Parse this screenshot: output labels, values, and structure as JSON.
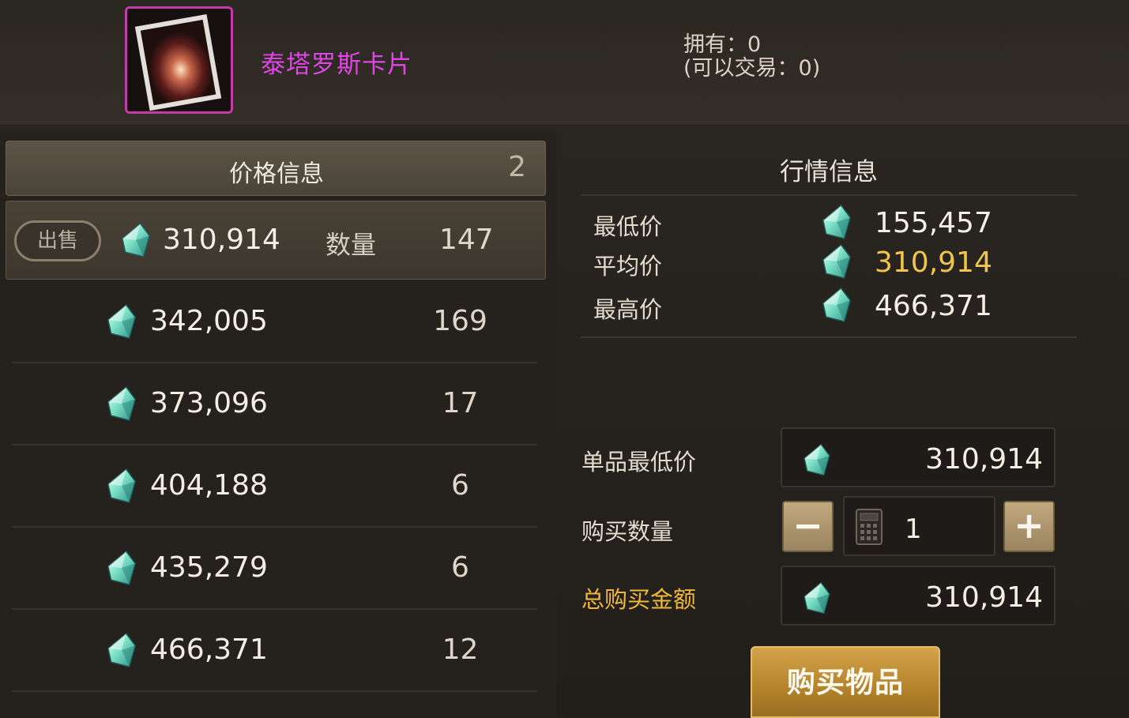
{
  "item": {
    "name": "泰塔罗斯卡片",
    "owned": "拥有：0",
    "tradable": "(可以交易：0)"
  },
  "price_info": {
    "title": "价格信息",
    "count": "2",
    "selected": {
      "sell_label": "出售",
      "price": "310,914",
      "qty_label": "数量",
      "qty": "147"
    },
    "rows": [
      {
        "price": "342,005",
        "qty": "169"
      },
      {
        "price": "373,096",
        "qty": "17"
      },
      {
        "price": "404,188",
        "qty": "6"
      },
      {
        "price": "435,279",
        "qty": "6"
      },
      {
        "price": "466,371",
        "qty": "12"
      }
    ]
  },
  "market": {
    "title": "行情信息",
    "min_label": "最低价",
    "min_value": "155,457",
    "avg_label": "平均价",
    "avg_value": "310,914",
    "max_label": "最高价",
    "max_value": "466,371"
  },
  "purchase": {
    "unit_min_label": "单品最低价",
    "unit_min_value": "310,914",
    "qty_label": "购买数量",
    "minus": "−",
    "plus": "+",
    "qty_value": "1",
    "total_label": "总购买金额",
    "total_value": "310,914",
    "buy_label": "购买物品"
  },
  "icons": {
    "currency": "gem-icon",
    "calculator": "calculator-icon",
    "item": "card-icon"
  },
  "colors": {
    "item_name": "#e046e6",
    "avg_price": "#f1c54c",
    "total_label": "#f0b73c",
    "buy_button": "#c39238"
  }
}
